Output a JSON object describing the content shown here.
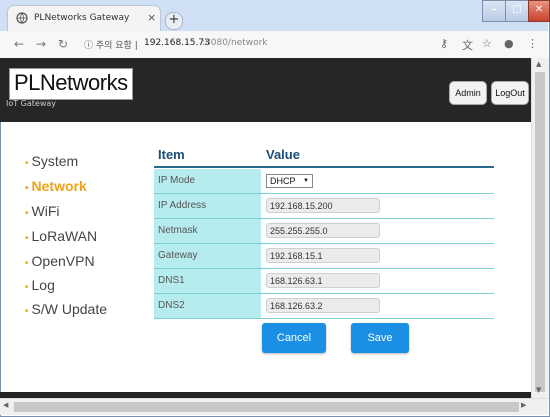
{
  "browser": {
    "tab_title": "PLNetworks Gateway",
    "tab_close": "×",
    "new_tab": "+",
    "url_security": "ⓘ 주의 요함 |",
    "url_host": "192.168.15.73",
    "url_rest": ":8080/network",
    "icons": [
      "back-icon",
      "forward-icon",
      "reload-icon",
      "key-icon",
      "translate-icon",
      "star-icon",
      "profile-icon",
      "menu-icon"
    ]
  },
  "header": {
    "logo": "PLNetworks",
    "subtitle": "IoT Gateway",
    "admin_label": "Admin",
    "logout_label": "LogOut"
  },
  "menu": {
    "items": [
      {
        "label": "System",
        "active": false
      },
      {
        "label": "Network",
        "active": true
      },
      {
        "label": "WiFi",
        "active": false
      },
      {
        "label": "LoRaWAN",
        "active": false
      },
      {
        "label": "OpenVPN",
        "active": false
      },
      {
        "label": "Log",
        "active": false
      },
      {
        "label": "S/W Update",
        "active": false
      }
    ],
    "active_color": "#f0a31a"
  },
  "table": {
    "col_item": "Item",
    "col_value": "Value",
    "rows": [
      {
        "label": "IP Mode",
        "value": "DHCP",
        "type": "select"
      },
      {
        "label": "IP Address",
        "value": "192.168.15.200",
        "type": "input"
      },
      {
        "label": "Netmask",
        "value": "255.255.255.0",
        "type": "input"
      },
      {
        "label": "Gateway",
        "value": "192.168.15.1",
        "type": "input"
      },
      {
        "label": "DNS1",
        "value": "168.126.63.1",
        "type": "input"
      },
      {
        "label": "DNS2",
        "value": "168.126.63.2",
        "type": "input"
      }
    ]
  },
  "actions": {
    "cancel_label": "Cancel",
    "save_label": "Save"
  }
}
